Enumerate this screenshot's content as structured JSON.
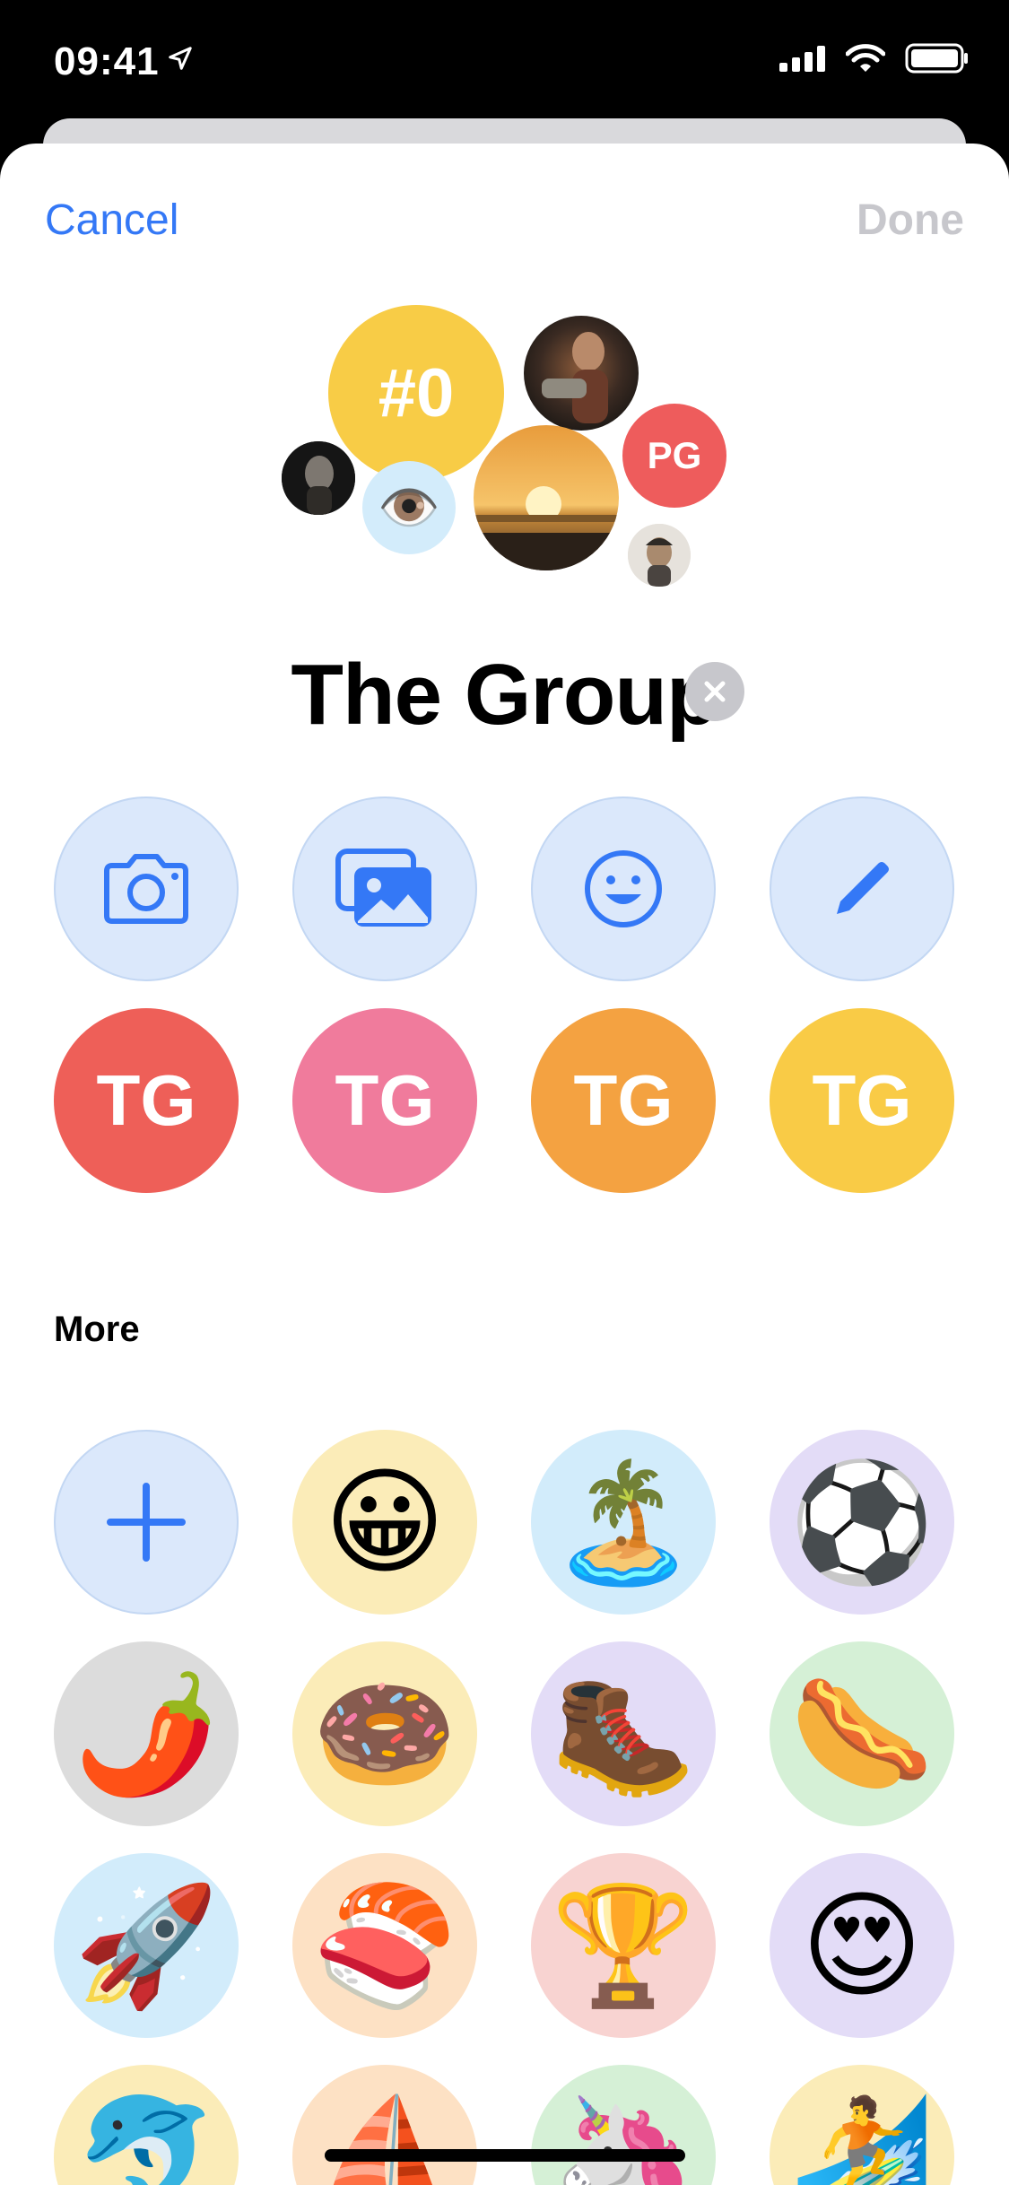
{
  "status": {
    "time": "09:41"
  },
  "nav": {
    "cancel": "Cancel",
    "done": "Done"
  },
  "collage": {
    "bubbles": [
      {
        "label": "#0",
        "color": "#f8cc46"
      },
      {
        "label": "PG",
        "color": "#ee5c5c"
      }
    ],
    "eye_emoji": "👁️"
  },
  "group": {
    "name": "The Group"
  },
  "tools": [
    "camera-icon",
    "photo-library-icon",
    "emoji-icon",
    "pencil-icon"
  ],
  "monograms": [
    {
      "label": "TG",
      "color": "#ee5f58"
    },
    {
      "label": "TG",
      "color": "#f07b9c"
    },
    {
      "label": "TG",
      "color": "#f4a241"
    },
    {
      "label": "TG",
      "color": "#f9cb46"
    }
  ],
  "more": {
    "title": "More",
    "items": [
      {
        "emoji": "+",
        "bg": "#dbe8fb"
      },
      {
        "emoji": "😀",
        "bg": "#fbecb8"
      },
      {
        "emoji": "🏝️",
        "bg": "#d2ecfb"
      },
      {
        "emoji": "⚽",
        "bg": "#e3dcf7"
      },
      {
        "emoji": "🌶️",
        "bg": "#dcdcdc"
      },
      {
        "emoji": "🍩",
        "bg": "#fbecb8"
      },
      {
        "emoji": "🥾",
        "bg": "#e3dcf7"
      },
      {
        "emoji": "🌭",
        "bg": "#d5f0d6"
      },
      {
        "emoji": "🚀",
        "bg": "#d2ecfb"
      },
      {
        "emoji": "🍣",
        "bg": "#fde1c4"
      },
      {
        "emoji": "🏆",
        "bg": "#f8d3d1"
      },
      {
        "emoji": "😍",
        "bg": "#e3dcf7"
      },
      {
        "emoji": "🐬",
        "bg": "#fbecb8"
      },
      {
        "emoji": "⛵",
        "bg": "#fde1c4"
      },
      {
        "emoji": "🦄",
        "bg": "#d5f0d6"
      },
      {
        "emoji": "🏄",
        "bg": "#fbecb8"
      }
    ]
  },
  "colors": {
    "accent": "#3478f6",
    "tool_bg": "#dbe8fb"
  }
}
